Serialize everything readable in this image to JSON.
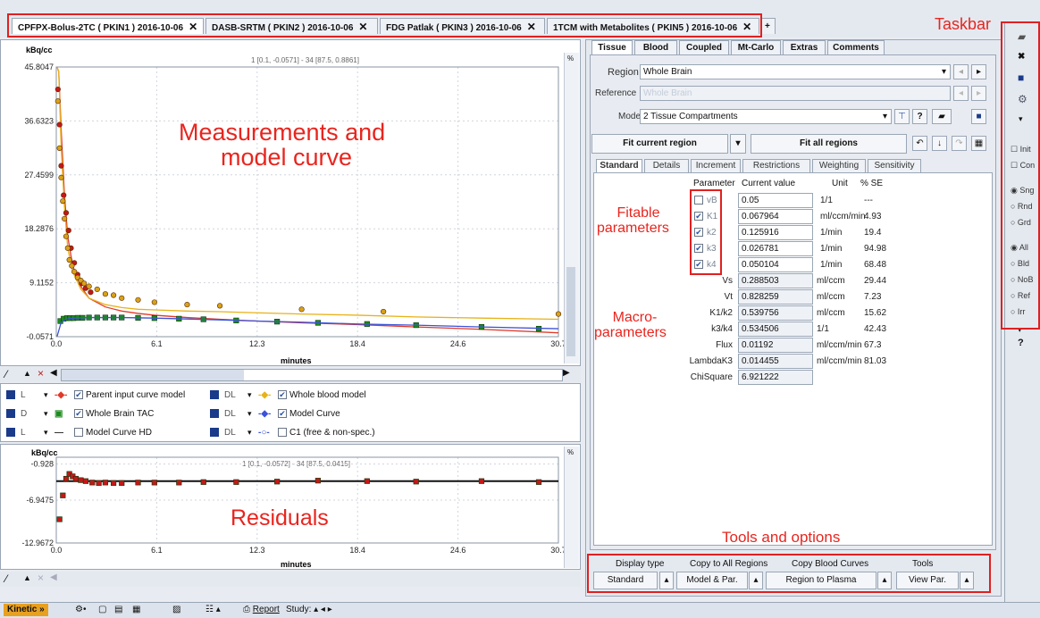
{
  "tabs": [
    {
      "label": "CPFPX-Bolus-2TC ( PKIN1 ) 2016-10-06",
      "active": true
    },
    {
      "label": "DASB-SRTM ( PKIN2 ) 2016-10-06",
      "active": false
    },
    {
      "label": "FDG Patlak ( PKIN3 ) 2016-10-06",
      "active": false
    },
    {
      "label": "1TCM with Metabolites ( PKIN5 ) 2016-10-06",
      "active": false
    }
  ],
  "tab_close_glyph": "✕",
  "tab_add_glyph": "+",
  "annotations": {
    "taskbar": "Taskbar",
    "measurements_line1": "Measurements and",
    "measurements_line2": "model curve",
    "fitable_line1": "Fitable",
    "fitable_line2": "parameters",
    "macro_line1": "Macro-",
    "macro_line2": "parameters",
    "residuals": "Residuals",
    "tools": "Tools and options"
  },
  "main_plot": {
    "unit": "kBq/cc",
    "info": "1 [0.1, -0.0571] - 34 [87.5, 0.8861]",
    "yticks": [
      "45.8047",
      "36.6323",
      "27.4599",
      "18.2876",
      "9.1152",
      "-0.0571"
    ],
    "xticks": [
      "0.0",
      "6.1",
      "12.3",
      "18.4",
      "24.6",
      "30.7"
    ],
    "xlabel": "minutes"
  },
  "chart_data": [
    {
      "type": "line",
      "title": "",
      "xlabel": "minutes",
      "ylabel": "kBq/cc",
      "xlim": [
        0,
        30.7
      ],
      "ylim": [
        -0.0571,
        45.8047
      ],
      "series": [
        {
          "name": "Parent input curve model",
          "color": "#e03a2a",
          "marker": "none",
          "x": [
            0.05,
            0.15,
            0.3,
            0.5,
            0.7,
            1.0,
            1.5,
            2,
            3,
            4,
            5,
            6,
            8,
            10,
            12.3,
            15,
            18.4,
            22,
            26,
            30.7
          ],
          "y": [
            45.8,
            45.0,
            35,
            24,
            17,
            12,
            8.5,
            6.5,
            5,
            4.3,
            3.9,
            3.6,
            3.2,
            2.9,
            2.6,
            2.3,
            2.0,
            1.6,
            1.2,
            0.6
          ]
        },
        {
          "name": "Whole blood model",
          "color": "#e8b21a",
          "marker": "none",
          "x": [
            0.05,
            0.15,
            0.3,
            0.5,
            0.7,
            1.0,
            1.5,
            2,
            3,
            4,
            5,
            6,
            8,
            10,
            12.3,
            15,
            18.4,
            22,
            26,
            30.7
          ],
          "y": [
            45.8,
            45.0,
            32,
            22,
            15,
            11,
            8,
            6.5,
            5.4,
            4.9,
            4.6,
            4.5,
            4.3,
            4.2,
            4.0,
            3.8,
            3.6,
            3.3,
            3.1,
            2.9
          ]
        },
        {
          "name": "Whole Brain TAC",
          "color": "#1e8a1e",
          "marker": "square",
          "x": [
            0.25,
            0.45,
            0.65,
            0.85,
            1.05,
            1.3,
            1.6,
            2.0,
            2.5,
            3.0,
            3.5,
            4.0,
            5.0,
            6.0,
            7.5,
            9,
            11,
            13.5,
            16,
            19,
            22,
            26,
            29.5
          ],
          "y": [
            2.6,
            3.0,
            3.1,
            3.1,
            3.1,
            3.15,
            3.15,
            3.2,
            3.2,
            3.2,
            3.2,
            3.2,
            3.15,
            3.1,
            3.0,
            2.9,
            2.7,
            2.5,
            2.3,
            2.1,
            1.9,
            1.6,
            1.3
          ]
        },
        {
          "name": "Model Curve",
          "color": "#3c52d8",
          "marker": "none",
          "x": [
            0.05,
            0.3,
            0.6,
            1,
            2,
            3,
            4,
            6,
            8,
            10,
            12.3,
            15,
            18.4,
            22,
            26,
            30.7
          ],
          "y": [
            0,
            2.4,
            2.9,
            3.1,
            3.2,
            3.2,
            3.2,
            3.1,
            2.95,
            2.8,
            2.6,
            2.4,
            2.1,
            1.9,
            1.6,
            1.3
          ]
        },
        {
          "name": "Blood samples",
          "color": "#c41818",
          "marker": "circle",
          "x": [
            0.1,
            0.2,
            0.3,
            0.45,
            0.6,
            0.75,
            0.9,
            1.1,
            1.3,
            1.55,
            1.8,
            2.1
          ],
          "y": [
            42,
            36,
            29,
            24,
            21,
            18,
            15,
            12.5,
            10.5,
            9,
            8.2,
            7.5
          ]
        },
        {
          "name": "Whole blood samples",
          "color": "#d9a118",
          "marker": "circle",
          "x": [
            0.1,
            0.2,
            0.3,
            0.4,
            0.5,
            0.6,
            0.7,
            0.8,
            0.95,
            1.1,
            1.3,
            1.5,
            1.7,
            2,
            2.5,
            3,
            3.5,
            4,
            5,
            6,
            8,
            10,
            15,
            20,
            30.7
          ],
          "y": [
            40,
            32,
            27,
            23,
            20,
            17,
            15,
            13,
            12,
            11,
            10,
            9.5,
            9,
            8.5,
            8,
            7.2,
            7,
            6.5,
            6.2,
            5.8,
            5.4,
            5.2,
            4.6,
            4.2,
            3.8
          ]
        }
      ]
    },
    {
      "type": "scatter",
      "title": "",
      "xlabel": "minutes",
      "ylabel": "kBq/cc",
      "xlim": [
        0,
        30.7
      ],
      "ylim": [
        -12.9672,
        5
      ],
      "series": [
        {
          "name": "Residuals",
          "color": "#c41818",
          "marker": "square",
          "x": [
            0.2,
            0.4,
            0.6,
            0.8,
            1.0,
            1.2,
            1.5,
            1.8,
            2.2,
            2.6,
            3.0,
            3.5,
            4.0,
            5.0,
            6.0,
            7.5,
            9,
            11,
            13.5,
            16,
            19,
            22,
            26,
            29.5
          ],
          "y": [
            -8,
            -3,
            0.5,
            1.5,
            1.0,
            0.5,
            0.2,
            0.0,
            -0.3,
            -0.4,
            -0.3,
            -0.4,
            -0.4,
            -0.3,
            -0.3,
            -0.3,
            -0.2,
            -0.2,
            -0.1,
            0.1,
            0.0,
            -0.1,
            0.0,
            -0.2
          ]
        }
      ]
    }
  ],
  "legend": [
    {
      "icon": "save",
      "flag": "L",
      "style": "line-diamond",
      "color": "#e03a2a",
      "checked": true,
      "label": "Parent input curve model"
    },
    {
      "icon": "save",
      "flag": "DL",
      "style": "line-diamond",
      "color": "#e8b21a",
      "checked": true,
      "label": "Whole blood model"
    },
    {
      "icon": "save",
      "flag": "D",
      "style": "square",
      "color": "#1e8a1e",
      "checked": true,
      "label": "Whole Brain TAC"
    },
    {
      "icon": "save",
      "flag": "DL",
      "style": "line-diamond",
      "color": "#3c52d8",
      "checked": true,
      "label": "Model Curve"
    },
    {
      "icon": "save",
      "flag": "L",
      "style": "line",
      "color": "#333333",
      "checked": false,
      "label": "Model Curve HD"
    },
    {
      "icon": "save",
      "flag": "DL",
      "style": "line-circle",
      "color": "#3c52d8",
      "checked": false,
      "label": "C1 (free & non-spec.)"
    }
  ],
  "residual_plot": {
    "unit": "kBq/cc",
    "info": "1 [0.1, -0.0572] - 34 [87.5, 0.0415]",
    "yticks": [
      "-0.928",
      "-6.9475",
      "-12.9672"
    ],
    "xticks": [
      "0.0",
      "6.1",
      "12.3",
      "18.4",
      "24.6",
      "30.7"
    ],
    "xlabel": "minutes"
  },
  "right_panel": {
    "top_tabs": [
      "Tissue",
      "Blood",
      "Coupled",
      "Mt-Carlo",
      "Extras",
      "Comments"
    ],
    "region_label": "Region",
    "region_value": "Whole Brain",
    "reference_label": "Reference",
    "reference_value": "Whole Brain",
    "model_label": "Model",
    "model_value": "2 Tissue Compartments",
    "fit_current": "Fit current region",
    "fit_all": "Fit all regions",
    "sub_tabs": [
      "Standard",
      "Details",
      "Increment",
      "Restrictions",
      "Weighting",
      "Sensitivity"
    ],
    "param_header": {
      "parameter": "Parameter",
      "value": "Current value",
      "unit": "Unit",
      "se": "% SE"
    },
    "fitable": [
      {
        "name": "vB",
        "checked": false,
        "value": "0.05",
        "unit": "1/1",
        "se": "---"
      },
      {
        "name": "K1",
        "checked": true,
        "value": "0.067964",
        "unit": "ml/ccm/min",
        "se": "4.93"
      },
      {
        "name": "k2",
        "checked": true,
        "value": "0.125916",
        "unit": "1/min",
        "se": "19.4"
      },
      {
        "name": "k3",
        "checked": true,
        "value": "0.026781",
        "unit": "1/min",
        "se": "94.98"
      },
      {
        "name": "k4",
        "checked": true,
        "value": "0.050104",
        "unit": "1/min",
        "se": "68.48"
      }
    ],
    "macro": [
      {
        "name": "Vs",
        "value": "0.288503",
        "unit": "ml/ccm",
        "se": "29.44"
      },
      {
        "name": "Vt",
        "value": "0.828259",
        "unit": "ml/ccm",
        "se": "7.23"
      },
      {
        "name": "K1/k2",
        "value": "0.539756",
        "unit": "ml/ccm",
        "se": "15.62"
      },
      {
        "name": "k3/k4",
        "value": "0.534506",
        "unit": "1/1",
        "se": "42.43"
      },
      {
        "name": "Flux",
        "value": "0.01192",
        "unit": "ml/ccm/min",
        "se": "67.3"
      },
      {
        "name": "LambdaK3",
        "value": "0.014455",
        "unit": "ml/ccm/min",
        "se": "81.03"
      },
      {
        "name": "ChiSquare",
        "value": "6.921222",
        "unit": "",
        "se": ""
      }
    ],
    "tools": {
      "display_type_label": "Display type",
      "display_type_value": "Standard",
      "copy_regions_label": "Copy to All Regions",
      "copy_regions_value": "Model & Par.",
      "copy_blood_label": "Copy Blood Curves",
      "copy_blood_value": "Region to Plasma",
      "tools_label": "Tools",
      "tools_value": "View Par."
    }
  },
  "sidebar": {
    "checks": [
      "Init",
      "Con"
    ],
    "radios1": [
      {
        "label": "Sng",
        "on": true
      },
      {
        "label": "Rnd",
        "on": false
      },
      {
        "label": "Grd",
        "on": false
      }
    ],
    "radios2": [
      {
        "label": "All",
        "on": true
      },
      {
        "label": "Bld",
        "on": false
      },
      {
        "label": "NoB",
        "on": false
      },
      {
        "label": "Ref",
        "on": false
      },
      {
        "label": "Irr",
        "on": false
      }
    ],
    "help": "?"
  },
  "status": {
    "kinetic": "Kinetic",
    "report": "Report",
    "study": "Study:"
  },
  "colors": {
    "accent": "#e8251e",
    "tab_bg": "#eef1f6",
    "panel_border": "#9aa6b5"
  }
}
